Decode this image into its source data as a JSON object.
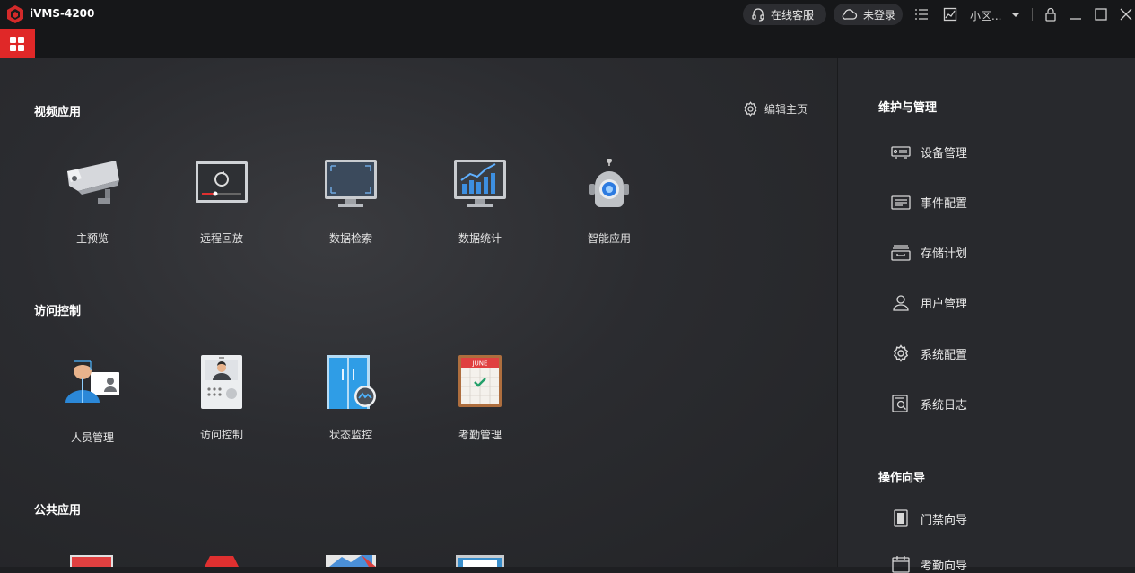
{
  "app": {
    "title": "iVMS-4200"
  },
  "titlebar": {
    "service_label": "在线客服",
    "login_label": "未登录",
    "user_label": "小区...",
    "icons": [
      "headset-icon",
      "cloud-icon",
      "list-icon",
      "chart-icon",
      "chevron-down-icon",
      "lock-icon",
      "minimize-icon",
      "maximize-icon",
      "close-icon"
    ]
  },
  "colors": {
    "accent": "#e02828",
    "background": "#2b2c30",
    "panel": "#28292d"
  },
  "main": {
    "edit_home_label": "编辑主页",
    "sections": [
      {
        "title": "视频应用",
        "apps": [
          "主预览",
          "远程回放",
          "数据检索",
          "数据统计",
          "智能应用"
        ]
      },
      {
        "title": "访问控制",
        "apps": [
          "人员管理",
          "访问控制",
          "状态监控",
          "考勤管理"
        ]
      },
      {
        "title": "公共应用",
        "apps": []
      }
    ],
    "calendar_month": "JUNE"
  },
  "right": {
    "maintenance_title": "维护与管理",
    "maintenance_items": [
      "设备管理",
      "事件配置",
      "存储计划",
      "用户管理",
      "系统配置",
      "系统日志"
    ],
    "wizard_title": "操作向导",
    "wizard_items": [
      "门禁向导",
      "考勤向导"
    ]
  }
}
